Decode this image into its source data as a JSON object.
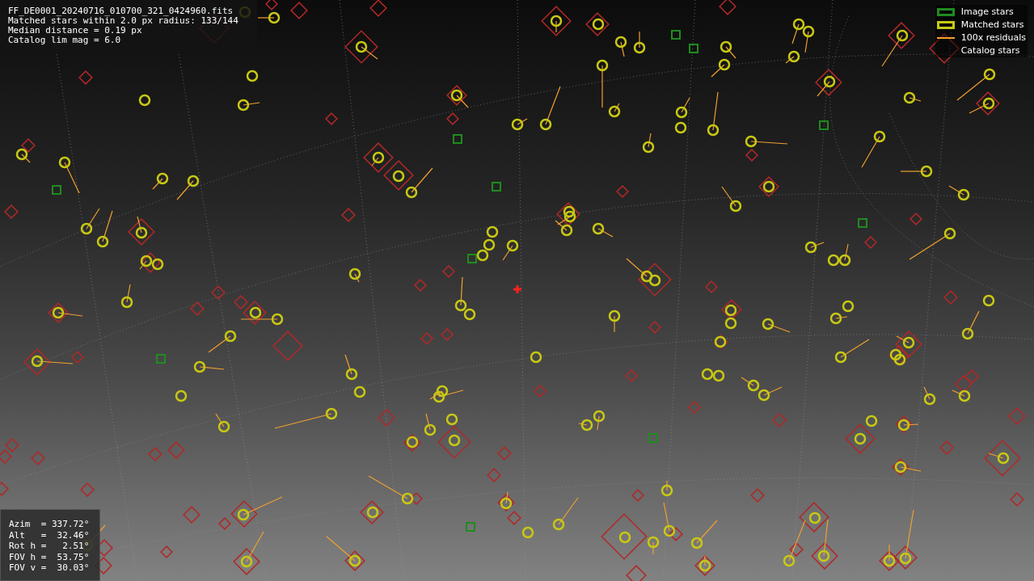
{
  "info_panel": {
    "lines": [
      "FF_DE0001_20240716_010700_321_0424960.fits",
      "Matched stars within 2.0 px radius: 133/144",
      "Median distance = 0.19 px",
      "Catalog lim mag = 6.0"
    ]
  },
  "legend": {
    "items": [
      {
        "label": "Image stars",
        "kind": "box",
        "color": "#1e8c1e"
      },
      {
        "label": "Matched stars",
        "kind": "box",
        "color": "#c8c814"
      },
      {
        "label": "100x residuals",
        "kind": "line",
        "color": "#f0a030"
      },
      {
        "label": "Catalog stars",
        "kind": "none"
      }
    ]
  },
  "pointing_panel": {
    "lines": [
      "Azim  = 337.72°",
      "Alt   =  32.46°",
      "Rot h =   2.51°",
      "FOV h =  53.75°",
      "FOV v =  30.03°"
    ]
  }
}
